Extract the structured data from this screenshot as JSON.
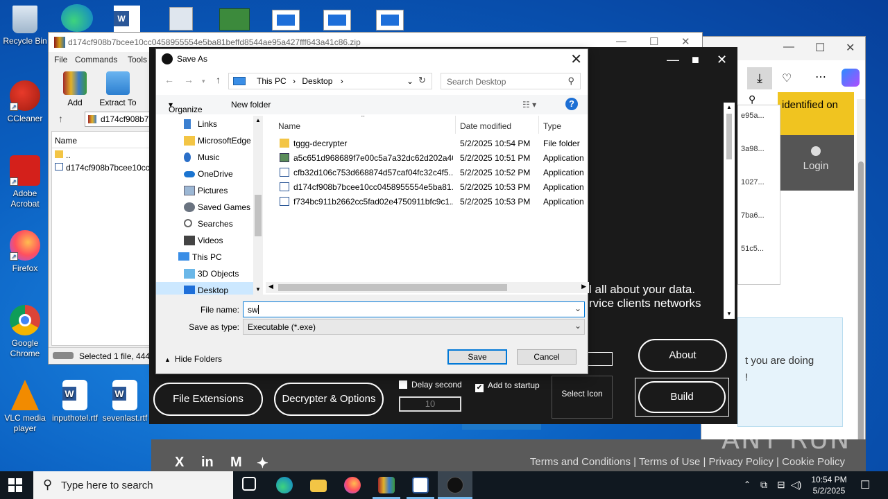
{
  "desktop": {
    "icons": [
      {
        "name": "recycle-bin",
        "label": "Recycle Bin"
      },
      {
        "name": "ccleaner",
        "label": "CCleaner"
      },
      {
        "name": "adobe-acrobat",
        "label": "Adobe\nAcrobat"
      },
      {
        "name": "firefox",
        "label": "Firefox"
      },
      {
        "name": "google-chrome",
        "label": "Google\nChrome"
      },
      {
        "name": "vlc",
        "label": "VLC media\nplayer"
      },
      {
        "name": "inputhotel",
        "label": "inputhotel.rtf"
      },
      {
        "name": "sevenlast",
        "label": "sevenlast.rtf"
      }
    ]
  },
  "winrar": {
    "title": "d174cf908b7bcee10cc0458955554e5ba81beffd8544ae95a427fff643a41c86.zip",
    "menu": [
      "File",
      "Commands",
      "Tools"
    ],
    "tools": [
      "Add",
      "Extract To"
    ],
    "address": "d174cf908b7b",
    "column_name": "Name",
    "rows": [
      "..",
      "d174cf908b7bcee10cc04"
    ],
    "status": "Selected 1 file, 444,4"
  },
  "browser": {
    "banner_text": "identified on",
    "login_label": "Login",
    "hash_items": [
      "e95a...",
      "3a98...",
      "1027...",
      "7ba6...",
      "51c5..."
    ],
    "info_text": "t you are doing\n!"
  },
  "builder": {
    "slogan_line1": "l all about your data.",
    "slogan_line2": "rvice clients networks",
    "buttons": {
      "file_extensions": "File Extensions",
      "decrypter_options": "Decrypter & Options",
      "about": "About",
      "build": "Build"
    },
    "delay_second_label": "Delay second",
    "delay_second_checked": false,
    "delay_value": "10",
    "add_to_startup_label": "Add to startup",
    "add_to_startup_checked": true,
    "select_icon_label": "Select Icon"
  },
  "web_footer": {
    "links": [
      "Terms and Conditions",
      "Terms of Use",
      "Privacy Policy",
      "Cookie Policy"
    ],
    "social": [
      "X",
      "in",
      "M",
      "bluesky"
    ]
  },
  "watermark": "ANY RUN",
  "save_as": {
    "title": "Save As",
    "breadcrumb": [
      "This PC",
      "Desktop"
    ],
    "search_placeholder": "Search Desktop",
    "organize_label": "Organize",
    "new_folder_label": "New folder",
    "nav_items": [
      {
        "label": "Links",
        "indent": 1
      },
      {
        "label": "MicrosoftEdge",
        "indent": 1
      },
      {
        "label": "Music",
        "indent": 1
      },
      {
        "label": "OneDrive",
        "indent": 1
      },
      {
        "label": "Pictures",
        "indent": 1
      },
      {
        "label": "Saved Games",
        "indent": 1
      },
      {
        "label": "Searches",
        "indent": 1
      },
      {
        "label": "Videos",
        "indent": 1
      },
      {
        "label": "This PC",
        "indent": 0
      },
      {
        "label": "3D Objects",
        "indent": 1
      },
      {
        "label": "Desktop",
        "indent": 1
      }
    ],
    "columns": [
      "Name",
      "Date modified",
      "Type"
    ],
    "files": [
      {
        "name": "tggg-decrypter",
        "date": "5/2/2025 10:54 PM",
        "type": "File folder",
        "kind": "folder"
      },
      {
        "name": "a5c651d968689f7e00c5a7a32dc62d202a40...",
        "date": "5/2/2025 10:51 PM",
        "type": "Application",
        "kind": "app"
      },
      {
        "name": "cfb32d106c753d668874d57caf04fc32c4f5...",
        "date": "5/2/2025 10:52 PM",
        "type": "Application",
        "kind": "app"
      },
      {
        "name": "d174cf908b7bcee10cc0458955554e5ba81...",
        "date": "5/2/2025 10:53 PM",
        "type": "Application",
        "kind": "app"
      },
      {
        "name": "f734bc911b2662cc5fad02e4750911bfc9c1...",
        "date": "5/2/2025 10:53 PM",
        "type": "Application",
        "kind": "app"
      }
    ],
    "file_name_label": "File name:",
    "file_name_value": "sw",
    "save_type_label": "Save as type:",
    "save_type_value": "Executable (*.exe)",
    "hide_folders_label": "Hide Folders",
    "save_label": "Save",
    "cancel_label": "Cancel"
  },
  "taskbar": {
    "search_placeholder": "Type here to search",
    "time": "10:54 PM",
    "date": "5/2/2025"
  }
}
